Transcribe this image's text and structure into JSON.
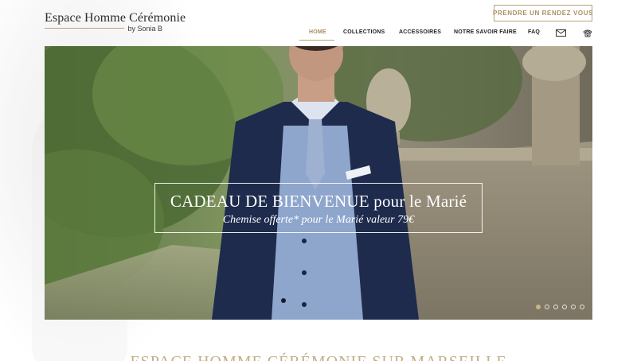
{
  "brand": {
    "title": "Espace Homme Cérémonie",
    "subtitle": "by Sonia B"
  },
  "cta": {
    "label": "PRENDRE UN RENDEZ VOUS"
  },
  "nav": {
    "items": [
      {
        "label": "HOME",
        "active": true
      },
      {
        "label": "COLLECTIONS"
      },
      {
        "label": "ACCESSOIRES"
      },
      {
        "label": "NOTRE SAVOIR FAIRE"
      },
      {
        "label": "FAQ"
      }
    ],
    "icons": [
      "mail-icon",
      "phone-icon"
    ]
  },
  "hero": {
    "caption_title": "CADEAU DE BIENVENUE pour le Marié",
    "caption_sub": "Chemise offerte* pour le Marié valeur 79€",
    "slides": 6,
    "active_slide": 1
  },
  "section": {
    "heading": "ESPACE HOMME CÉRÉMONIE SUR MARSEILLE"
  },
  "colors": {
    "accent": "#a88f5f",
    "accent_light": "#c2ae87"
  }
}
